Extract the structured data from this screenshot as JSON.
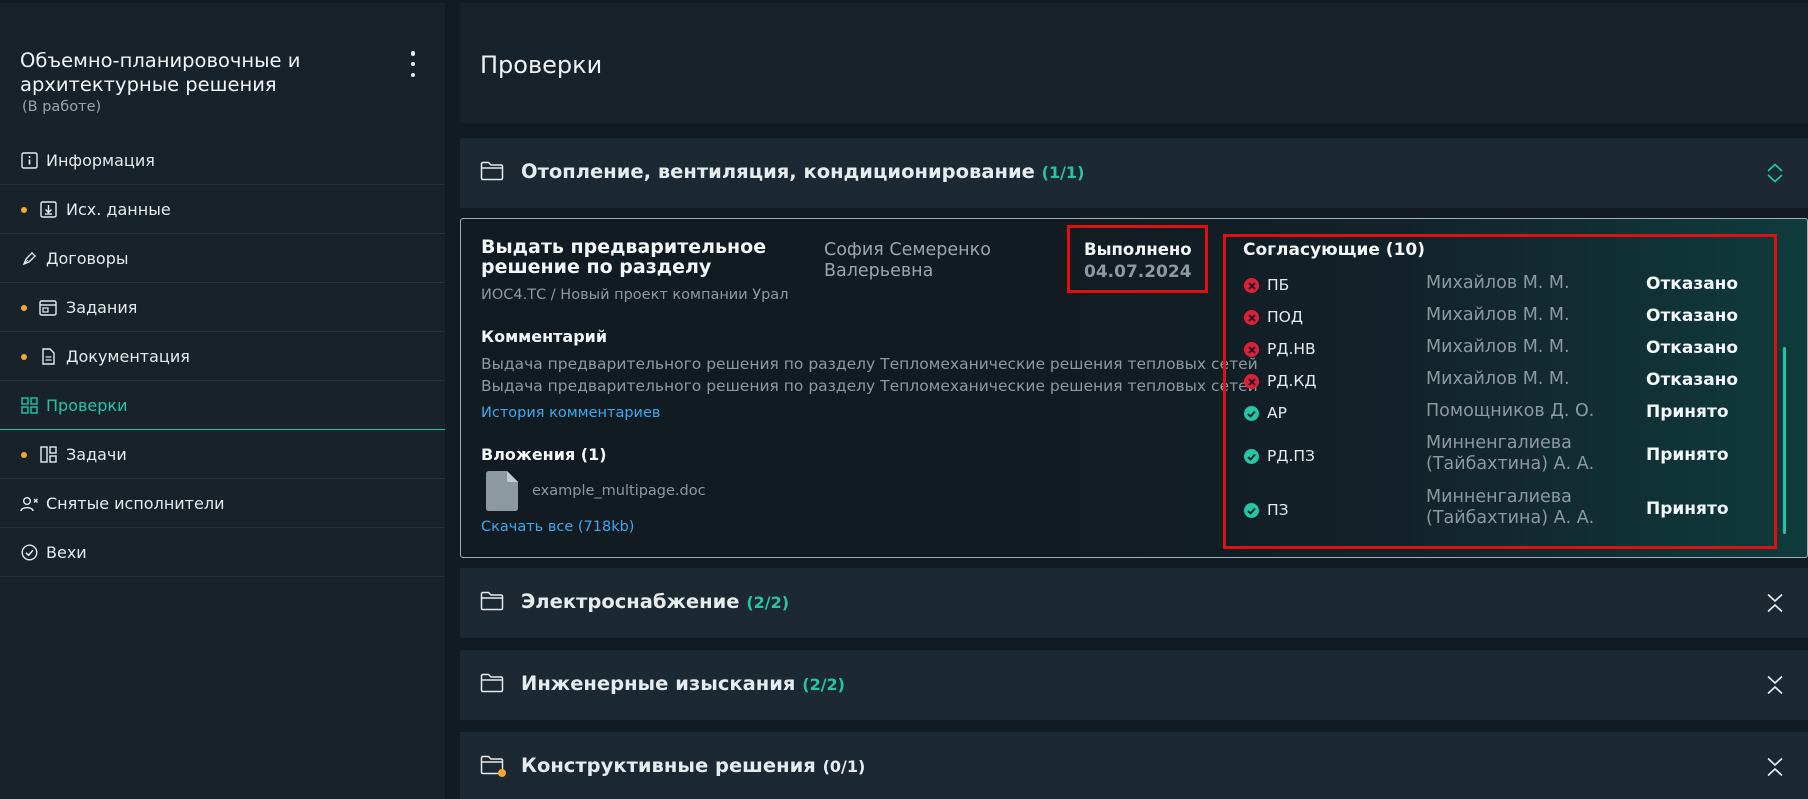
{
  "project": {
    "title": "Объемно-планировочные и архитектурные решения",
    "status": "(В работе)"
  },
  "sidebar": {
    "items": [
      {
        "label": "Информация",
        "icon": "info-icon",
        "dot": false
      },
      {
        "label": "Исх. данные",
        "icon": "download-box-icon",
        "dot": true
      },
      {
        "label": "Договоры",
        "icon": "pen-icon",
        "dot": false
      },
      {
        "label": "Задания",
        "icon": "window-icon",
        "dot": true
      },
      {
        "label": "Документация",
        "icon": "document-icon",
        "dot": true
      },
      {
        "label": "Проверки",
        "icon": "grid-icon",
        "dot": false,
        "active": true
      },
      {
        "label": "Задачи",
        "icon": "layout-icon",
        "dot": true
      },
      {
        "label": "Снятые исполнители",
        "icon": "user-remove-icon",
        "dot": false
      },
      {
        "label": "Вехи",
        "icon": "check-circle-icon",
        "dot": false
      }
    ]
  },
  "main": {
    "title": "Проверки",
    "sections": [
      {
        "name": "Отопление, вентиляция, кондиционирование",
        "count": "(1/1)",
        "expanded": true
      },
      {
        "name": "Электроснабжение",
        "count": "(2/2)",
        "expanded": false
      },
      {
        "name": "Инженерные изыскания",
        "count": "(2/2)",
        "expanded": false
      },
      {
        "name": "Конструктивные решения",
        "count": "(0/1)",
        "expanded": false
      }
    ],
    "task": {
      "title": "Выдать предварительное решение по разделу",
      "path": "ИОС4.ТС / Новый проект компании Урал",
      "assignee": "София Семеренко Валерьевна",
      "status": "Выполнено",
      "date": "04.07.2024",
      "comment_heading": "Комментарий",
      "comments": [
        "Выдача предварительного решения по разделу Тепломеханические решения тепловых сетей",
        "Выдача предварительного решения по разделу Тепломеханические решения тепловых сетей"
      ],
      "history_link": "История комментариев",
      "attachments_heading": "Вложения (1)",
      "file_name": "example_multipage.doc",
      "download_link": "Скачать все (718kb)",
      "approvers_heading": "Согласующие (10)",
      "approvers": [
        {
          "code": "ПБ",
          "person": "Михайлов М. М.",
          "result": "Отказано",
          "state": "rejected"
        },
        {
          "code": "ПОД",
          "person": "Михайлов М. М.",
          "result": "Отказано",
          "state": "rejected"
        },
        {
          "code": "РД.НВ",
          "person": "Михайлов М. М.",
          "result": "Отказано",
          "state": "rejected"
        },
        {
          "code": "РД.КД",
          "person": "Михайлов М. М.",
          "result": "Отказано",
          "state": "rejected"
        },
        {
          "code": "АР",
          "person": "Помощников Д. О.",
          "result": "Принято",
          "state": "accepted"
        },
        {
          "code": "РД.ПЗ",
          "person": "Минненгалиева (Тайбахтина) А. А.",
          "result": "Принято",
          "state": "accepted"
        },
        {
          "code": "ПЗ",
          "person": "Минненгалиева (Тайбахтина) А. А.",
          "result": "Принято",
          "state": "accepted"
        }
      ]
    }
  },
  "colors": {
    "accent": "#27c4a6",
    "reject": "#e0203a",
    "link": "#3fa8ee",
    "dot": "#f3a72e",
    "highlight": "#e01010"
  }
}
